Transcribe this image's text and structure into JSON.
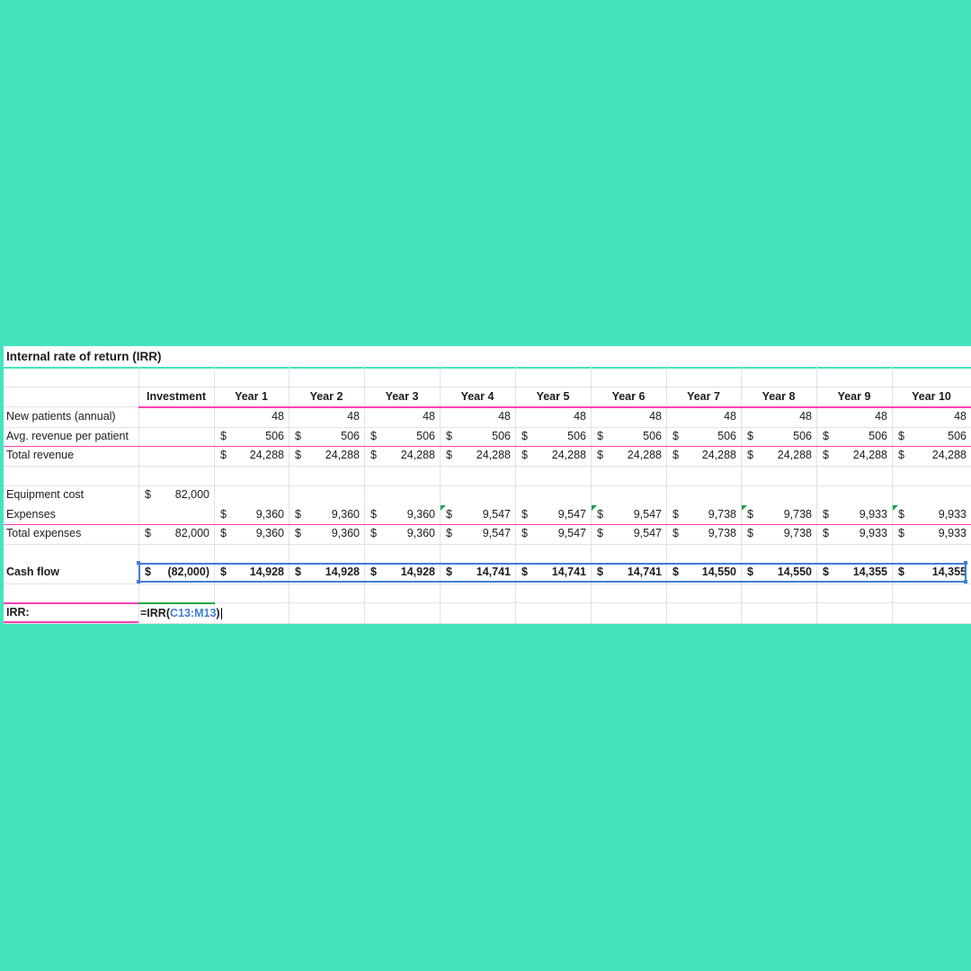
{
  "title": "Internal rate of return (IRR)",
  "columns": [
    "Investment",
    "Year 1",
    "Year 2",
    "Year 3",
    "Year 4",
    "Year 5",
    "Year 6",
    "Year 7",
    "Year 8",
    "Year 9",
    "Year 10"
  ],
  "currency_symbol": "$",
  "rows": {
    "new_patients": {
      "label": "New patients (annual)",
      "values": [
        "48",
        "48",
        "48",
        "48",
        "48",
        "48",
        "48",
        "48",
        "48",
        "48"
      ]
    },
    "avg_revenue": {
      "label": "Avg. revenue per patient",
      "values": [
        "506",
        "506",
        "506",
        "506",
        "506",
        "506",
        "506",
        "506",
        "506",
        "506"
      ]
    },
    "total_revenue": {
      "label": "Total revenue",
      "values": [
        "24,288",
        "24,288",
        "24,288",
        "24,288",
        "24,288",
        "24,288",
        "24,288",
        "24,288",
        "24,288",
        "24,288"
      ]
    },
    "equipment_cost": {
      "label": "Equipment cost",
      "investment": "82,000"
    },
    "expenses": {
      "label": "Expenses",
      "values": [
        "9,360",
        "9,360",
        "9,360",
        "9,547",
        "9,547",
        "9,547",
        "9,738",
        "9,738",
        "9,933",
        "9,933"
      ]
    },
    "total_expenses": {
      "label": "Total expenses",
      "investment": "82,000",
      "values": [
        "9,360",
        "9,360",
        "9,360",
        "9,547",
        "9,547",
        "9,547",
        "9,738",
        "9,738",
        "9,933",
        "9,933"
      ]
    },
    "cash_flow": {
      "label": "Cash flow",
      "investment": "(82,000)",
      "values": [
        "14,928",
        "14,928",
        "14,928",
        "14,741",
        "14,741",
        "14,741",
        "14,550",
        "14,550",
        "14,355",
        "14,355"
      ]
    }
  },
  "irr": {
    "label": "IRR:",
    "formula_prefix": "=IRR(",
    "formula_ref": "C13:M13",
    "formula_suffix": ")"
  },
  "colors": {
    "accent_teal": "#45e3be",
    "accent_pink": "#ff3fb2",
    "selection_blue": "#3f7dd6",
    "formula_green": "#16a34a"
  }
}
